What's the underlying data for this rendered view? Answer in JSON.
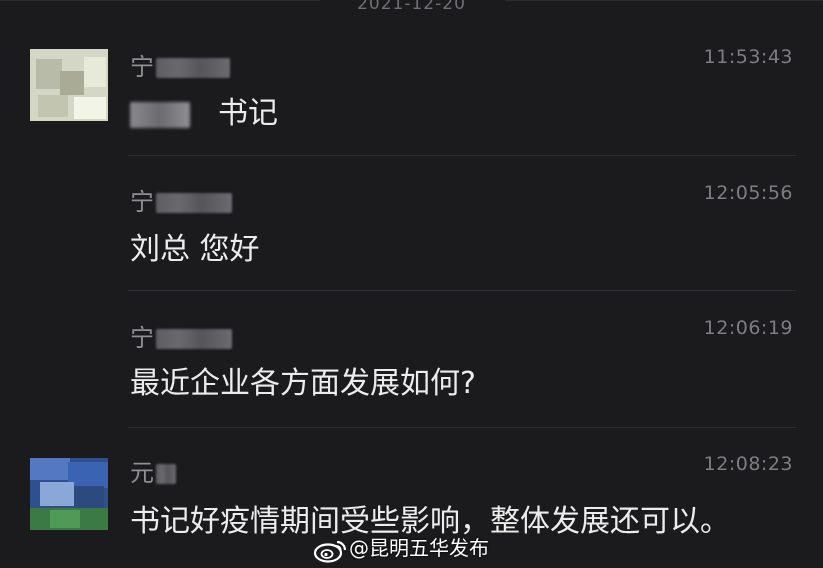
{
  "chat": {
    "date": "2021-12-20",
    "messages": [
      {
        "sender": "宁",
        "time": "11:53:43",
        "text": "书记"
      },
      {
        "sender": "宁",
        "time": "12:05:56",
        "text": "刘总 您好"
      },
      {
        "sender": "宁",
        "time": "12:06:19",
        "text": "最近企业各方面发展如何?"
      },
      {
        "sender": "元",
        "time": "12:08:23",
        "text": "书记好疫情期间受些影响，整体发展还可以。"
      }
    ]
  },
  "watermark": {
    "icon": "weibo-icon",
    "text": "@昆明五华发布"
  },
  "colors": {
    "background": "#1b1b1d",
    "text": "#ececec",
    "muted": "#7d7d82"
  }
}
